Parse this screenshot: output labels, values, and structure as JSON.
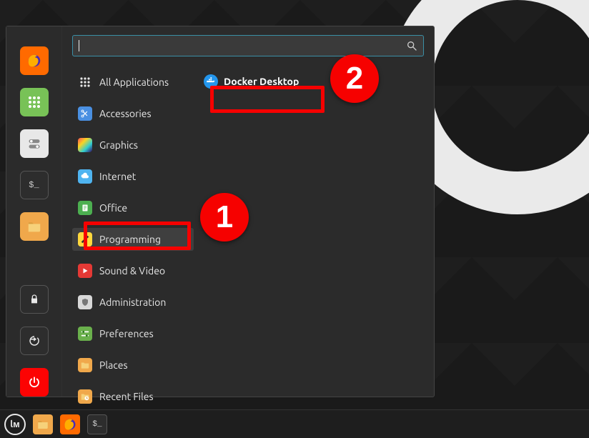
{
  "search": {
    "placeholder": ""
  },
  "favorites": [
    {
      "name": "firefox",
      "bg": "#ff6a00"
    },
    {
      "name": "apps-grid",
      "bg": "#78c257"
    },
    {
      "name": "settings",
      "bg": "#e8e8e8"
    },
    {
      "name": "terminal",
      "bg": "#2d2d2d"
    },
    {
      "name": "files",
      "bg": "#f0a84b"
    }
  ],
  "session_buttons": [
    {
      "name": "lock",
      "bg": "#2d2d2d"
    },
    {
      "name": "logout",
      "bg": "#2d2d2d"
    },
    {
      "name": "power",
      "bg": "#fc0303"
    }
  ],
  "categories": [
    {
      "key": "all",
      "label": "All Applications",
      "selected": false
    },
    {
      "key": "accessories",
      "label": "Accessories",
      "selected": false
    },
    {
      "key": "graphics",
      "label": "Graphics",
      "selected": false
    },
    {
      "key": "internet",
      "label": "Internet",
      "selected": false
    },
    {
      "key": "office",
      "label": "Office",
      "selected": false
    },
    {
      "key": "programming",
      "label": "Programming",
      "selected": true
    },
    {
      "key": "soundvideo",
      "label": "Sound & Video",
      "selected": false
    },
    {
      "key": "admin",
      "label": "Administration",
      "selected": false
    },
    {
      "key": "preferences",
      "label": "Preferences",
      "selected": false
    },
    {
      "key": "places",
      "label": "Places",
      "selected": false
    },
    {
      "key": "recent",
      "label": "Recent Files",
      "selected": false
    }
  ],
  "apps": [
    {
      "key": "docker-desktop",
      "label": "Docker Desktop"
    }
  ],
  "callouts": {
    "c1": "1",
    "c2": "2"
  },
  "taskbar": [
    {
      "name": "mint-menu"
    },
    {
      "name": "files"
    },
    {
      "name": "firefox"
    },
    {
      "name": "terminal"
    }
  ]
}
